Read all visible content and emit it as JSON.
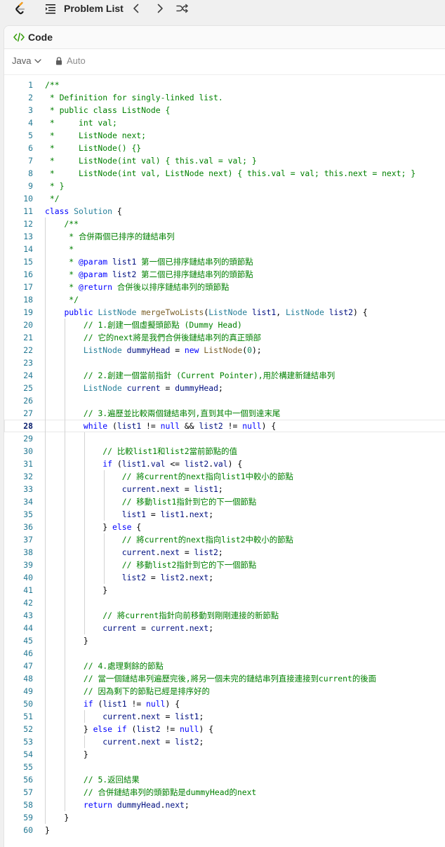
{
  "header": {
    "problem_list_label": "Problem List"
  },
  "panel": {
    "tab_label": "Code",
    "language": "Java",
    "mode": "Auto"
  },
  "editor": {
    "active_line": 28,
    "lines": [
      {
        "n": "1",
        "indent": 0,
        "tokens": [
          [
            "cm",
            "/**"
          ]
        ]
      },
      {
        "n": "2",
        "indent": 0,
        "tokens": [
          [
            "cm",
            " * Definition for singly-linked list."
          ]
        ]
      },
      {
        "n": "3",
        "indent": 0,
        "tokens": [
          [
            "cm",
            " * public class ListNode {"
          ]
        ]
      },
      {
        "n": "4",
        "indent": 0,
        "tokens": [
          [
            "cm",
            " *     int val;"
          ]
        ]
      },
      {
        "n": "5",
        "indent": 0,
        "tokens": [
          [
            "cm",
            " *     ListNode next;"
          ]
        ]
      },
      {
        "n": "6",
        "indent": 0,
        "tokens": [
          [
            "cm",
            " *     ListNode() {}"
          ]
        ]
      },
      {
        "n": "7",
        "indent": 0,
        "tokens": [
          [
            "cm",
            " *     ListNode(int val) { this.val = val; }"
          ]
        ]
      },
      {
        "n": "8",
        "indent": 0,
        "tokens": [
          [
            "cm",
            " *     ListNode(int val, ListNode next) { this.val = val; this.next = next; }"
          ]
        ]
      },
      {
        "n": "9",
        "indent": 0,
        "tokens": [
          [
            "cm",
            " * }"
          ]
        ]
      },
      {
        "n": "10",
        "indent": 0,
        "tokens": [
          [
            "cm",
            " */"
          ]
        ]
      },
      {
        "n": "11",
        "indent": 0,
        "tokens": [
          [
            "kw",
            "class"
          ],
          [
            "pl",
            " "
          ],
          [
            "ty",
            "Solution"
          ],
          [
            "pl",
            " {"
          ]
        ]
      },
      {
        "n": "12",
        "indent": 1,
        "tokens": [
          [
            "cm",
            "    /**"
          ]
        ]
      },
      {
        "n": "13",
        "indent": 1,
        "tokens": [
          [
            "cm",
            "     * 合併兩個已排序的鏈結串列"
          ]
        ]
      },
      {
        "n": "14",
        "indent": 1,
        "tokens": [
          [
            "cm",
            "     *"
          ]
        ]
      },
      {
        "n": "15",
        "indent": 1,
        "tokens": [
          [
            "cm",
            "     * "
          ],
          [
            "doc",
            "@param"
          ],
          [
            "cm",
            " "
          ],
          [
            "va",
            "list1"
          ],
          [
            "cm",
            " 第一個已排序鏈結串列的頭節點"
          ]
        ]
      },
      {
        "n": "16",
        "indent": 1,
        "tokens": [
          [
            "cm",
            "     * "
          ],
          [
            "doc",
            "@param"
          ],
          [
            "cm",
            " "
          ],
          [
            "va",
            "list2"
          ],
          [
            "cm",
            " 第二個已排序鏈結串列的頭節點"
          ]
        ]
      },
      {
        "n": "17",
        "indent": 1,
        "tokens": [
          [
            "cm",
            "     * "
          ],
          [
            "doc",
            "@return"
          ],
          [
            "cm",
            " 合併後以排序鏈結串列的頭節點"
          ]
        ]
      },
      {
        "n": "18",
        "indent": 1,
        "tokens": [
          [
            "cm",
            "     */"
          ]
        ]
      },
      {
        "n": "19",
        "indent": 1,
        "tokens": [
          [
            "pl",
            "    "
          ],
          [
            "kw",
            "public"
          ],
          [
            "pl",
            " "
          ],
          [
            "ty",
            "ListNode"
          ],
          [
            "pl",
            " "
          ],
          [
            "fn",
            "mergeTwoLists"
          ],
          [
            "pl",
            "("
          ],
          [
            "ty",
            "ListNode"
          ],
          [
            "pl",
            " "
          ],
          [
            "va",
            "list1"
          ],
          [
            "pl",
            ", "
          ],
          [
            "ty",
            "ListNode"
          ],
          [
            "pl",
            " "
          ],
          [
            "va",
            "list2"
          ],
          [
            "pl",
            ") {"
          ]
        ]
      },
      {
        "n": "20",
        "indent": 2,
        "tokens": [
          [
            "pl",
            "        "
          ],
          [
            "cm",
            "// 1.創建一個虛擬頭節點 (Dummy Head)"
          ]
        ]
      },
      {
        "n": "21",
        "indent": 2,
        "tokens": [
          [
            "pl",
            "        "
          ],
          [
            "cm",
            "// 它的next將是我們合併後鏈結串列的真正頭部"
          ]
        ]
      },
      {
        "n": "22",
        "indent": 2,
        "tokens": [
          [
            "pl",
            "        "
          ],
          [
            "ty",
            "ListNode"
          ],
          [
            "pl",
            " "
          ],
          [
            "va",
            "dummyHead"
          ],
          [
            "pl",
            " = "
          ],
          [
            "kw",
            "new"
          ],
          [
            "pl",
            " "
          ],
          [
            "fn",
            "ListNode"
          ],
          [
            "pl",
            "("
          ],
          [
            "nu",
            "0"
          ],
          [
            "pl",
            ");"
          ]
        ]
      },
      {
        "n": "23",
        "indent": 2,
        "tokens": []
      },
      {
        "n": "24",
        "indent": 2,
        "tokens": [
          [
            "pl",
            "        "
          ],
          [
            "cm",
            "// 2.創建一個當前指針 (Current Pointer),用於構建新鏈結串列"
          ]
        ]
      },
      {
        "n": "25",
        "indent": 2,
        "tokens": [
          [
            "pl",
            "        "
          ],
          [
            "ty",
            "ListNode"
          ],
          [
            "pl",
            " "
          ],
          [
            "va",
            "current"
          ],
          [
            "pl",
            " = "
          ],
          [
            "va",
            "dummyHead"
          ],
          [
            "pl",
            ";"
          ]
        ]
      },
      {
        "n": "26",
        "indent": 2,
        "tokens": []
      },
      {
        "n": "27",
        "indent": 2,
        "tokens": [
          [
            "pl",
            "        "
          ],
          [
            "cm",
            "// 3.遍歷並比較兩個鏈結串列,直到其中一個到達末尾"
          ]
        ]
      },
      {
        "n": "28",
        "indent": 2,
        "tokens": [
          [
            "pl",
            "        "
          ],
          [
            "kw",
            "while"
          ],
          [
            "pl",
            " ("
          ],
          [
            "va",
            "list1"
          ],
          [
            "pl",
            " != "
          ],
          [
            "kw",
            "null"
          ],
          [
            "pl",
            " && "
          ],
          [
            "va",
            "list2"
          ],
          [
            "pl",
            " != "
          ],
          [
            "kw",
            "null"
          ],
          [
            "pl",
            ") {"
          ]
        ]
      },
      {
        "n": "29",
        "indent": 3,
        "tokens": []
      },
      {
        "n": "30",
        "indent": 3,
        "tokens": [
          [
            "pl",
            "            "
          ],
          [
            "cm",
            "// 比較list1和list2當前節點的值"
          ]
        ]
      },
      {
        "n": "31",
        "indent": 3,
        "tokens": [
          [
            "pl",
            "            "
          ],
          [
            "kw",
            "if"
          ],
          [
            "pl",
            " ("
          ],
          [
            "va",
            "list1"
          ],
          [
            "pl",
            "."
          ],
          [
            "va",
            "val"
          ],
          [
            "pl",
            " <= "
          ],
          [
            "va",
            "list2"
          ],
          [
            "pl",
            "."
          ],
          [
            "va",
            "val"
          ],
          [
            "pl",
            ") {"
          ]
        ]
      },
      {
        "n": "32",
        "indent": 4,
        "tokens": [
          [
            "pl",
            "                "
          ],
          [
            "cm",
            "// 將current的next指向list1中較小的節點"
          ]
        ]
      },
      {
        "n": "33",
        "indent": 4,
        "tokens": [
          [
            "pl",
            "                "
          ],
          [
            "va",
            "current"
          ],
          [
            "pl",
            "."
          ],
          [
            "va",
            "next"
          ],
          [
            "pl",
            " = "
          ],
          [
            "va",
            "list1"
          ],
          [
            "pl",
            ";"
          ]
        ]
      },
      {
        "n": "34",
        "indent": 4,
        "tokens": [
          [
            "pl",
            "                "
          ],
          [
            "cm",
            "// 移動list1指針到它的下一個節點"
          ]
        ]
      },
      {
        "n": "35",
        "indent": 4,
        "tokens": [
          [
            "pl",
            "                "
          ],
          [
            "va",
            "list1"
          ],
          [
            "pl",
            " = "
          ],
          [
            "va",
            "list1"
          ],
          [
            "pl",
            "."
          ],
          [
            "va",
            "next"
          ],
          [
            "pl",
            ";"
          ]
        ]
      },
      {
        "n": "36",
        "indent": 3,
        "tokens": [
          [
            "pl",
            "            } "
          ],
          [
            "kw",
            "else"
          ],
          [
            "pl",
            " {"
          ]
        ]
      },
      {
        "n": "37",
        "indent": 4,
        "tokens": [
          [
            "pl",
            "                "
          ],
          [
            "cm",
            "// 將current的next指向list2中較小的節點"
          ]
        ]
      },
      {
        "n": "38",
        "indent": 4,
        "tokens": [
          [
            "pl",
            "                "
          ],
          [
            "va",
            "current"
          ],
          [
            "pl",
            "."
          ],
          [
            "va",
            "next"
          ],
          [
            "pl",
            " = "
          ],
          [
            "va",
            "list2"
          ],
          [
            "pl",
            ";"
          ]
        ]
      },
      {
        "n": "39",
        "indent": 4,
        "tokens": [
          [
            "pl",
            "                "
          ],
          [
            "cm",
            "// 移動list2指針到它的下一個節點"
          ]
        ]
      },
      {
        "n": "40",
        "indent": 4,
        "tokens": [
          [
            "pl",
            "                "
          ],
          [
            "va",
            "list2"
          ],
          [
            "pl",
            " = "
          ],
          [
            "va",
            "list2"
          ],
          [
            "pl",
            "."
          ],
          [
            "va",
            "next"
          ],
          [
            "pl",
            ";"
          ]
        ]
      },
      {
        "n": "41",
        "indent": 3,
        "tokens": [
          [
            "pl",
            "            }"
          ]
        ]
      },
      {
        "n": "42",
        "indent": 3,
        "tokens": []
      },
      {
        "n": "43",
        "indent": 3,
        "tokens": [
          [
            "pl",
            "            "
          ],
          [
            "cm",
            "// 將current指針向前移動到剛剛連接的新節點"
          ]
        ]
      },
      {
        "n": "44",
        "indent": 3,
        "tokens": [
          [
            "pl",
            "            "
          ],
          [
            "va",
            "current"
          ],
          [
            "pl",
            " = "
          ],
          [
            "va",
            "current"
          ],
          [
            "pl",
            "."
          ],
          [
            "va",
            "next"
          ],
          [
            "pl",
            ";"
          ]
        ]
      },
      {
        "n": "45",
        "indent": 2,
        "tokens": [
          [
            "pl",
            "        }"
          ]
        ]
      },
      {
        "n": "46",
        "indent": 2,
        "tokens": []
      },
      {
        "n": "47",
        "indent": 2,
        "tokens": [
          [
            "pl",
            "        "
          ],
          [
            "cm",
            "// 4.處理剩餘的節點"
          ]
        ]
      },
      {
        "n": "48",
        "indent": 2,
        "tokens": [
          [
            "pl",
            "        "
          ],
          [
            "cm",
            "// 當一個鏈結串列遍歷完後,將另一個未完的鏈結串列直接連接到current的後面"
          ]
        ]
      },
      {
        "n": "49",
        "indent": 2,
        "tokens": [
          [
            "pl",
            "        "
          ],
          [
            "cm",
            "// 因為剩下的節點已經是排序好的"
          ]
        ]
      },
      {
        "n": "50",
        "indent": 2,
        "tokens": [
          [
            "pl",
            "        "
          ],
          [
            "kw",
            "if"
          ],
          [
            "pl",
            " ("
          ],
          [
            "va",
            "list1"
          ],
          [
            "pl",
            " != "
          ],
          [
            "kw",
            "null"
          ],
          [
            "pl",
            ") {"
          ]
        ]
      },
      {
        "n": "51",
        "indent": 3,
        "tokens": [
          [
            "pl",
            "            "
          ],
          [
            "va",
            "current"
          ],
          [
            "pl",
            "."
          ],
          [
            "va",
            "next"
          ],
          [
            "pl",
            " = "
          ],
          [
            "va",
            "list1"
          ],
          [
            "pl",
            ";"
          ]
        ]
      },
      {
        "n": "52",
        "indent": 2,
        "tokens": [
          [
            "pl",
            "        } "
          ],
          [
            "kw",
            "else"
          ],
          [
            "pl",
            " "
          ],
          [
            "kw",
            "if"
          ],
          [
            "pl",
            " ("
          ],
          [
            "va",
            "list2"
          ],
          [
            "pl",
            " != "
          ],
          [
            "kw",
            "null"
          ],
          [
            "pl",
            ") {"
          ]
        ]
      },
      {
        "n": "53",
        "indent": 3,
        "tokens": [
          [
            "pl",
            "            "
          ],
          [
            "va",
            "current"
          ],
          [
            "pl",
            "."
          ],
          [
            "va",
            "next"
          ],
          [
            "pl",
            " = "
          ],
          [
            "va",
            "list2"
          ],
          [
            "pl",
            ";"
          ]
        ]
      },
      {
        "n": "54",
        "indent": 2,
        "tokens": [
          [
            "pl",
            "        }"
          ]
        ]
      },
      {
        "n": "55",
        "indent": 2,
        "tokens": []
      },
      {
        "n": "56",
        "indent": 2,
        "tokens": [
          [
            "pl",
            "        "
          ],
          [
            "cm",
            "// 5.返回結果"
          ]
        ]
      },
      {
        "n": "57",
        "indent": 2,
        "tokens": [
          [
            "pl",
            "        "
          ],
          [
            "cm",
            "// 合併鏈結串列的頭節點是dummyHead的next"
          ]
        ]
      },
      {
        "n": "58",
        "indent": 2,
        "tokens": [
          [
            "pl",
            "        "
          ],
          [
            "kw",
            "return"
          ],
          [
            "pl",
            " "
          ],
          [
            "va",
            "dummyHead"
          ],
          [
            "pl",
            "."
          ],
          [
            "va",
            "next"
          ],
          [
            "pl",
            ";"
          ]
        ]
      },
      {
        "n": "59",
        "indent": 1,
        "tokens": [
          [
            "pl",
            "    }"
          ]
        ]
      },
      {
        "n": "60",
        "indent": 0,
        "tokens": [
          [
            "pl",
            "}"
          ]
        ]
      }
    ]
  }
}
